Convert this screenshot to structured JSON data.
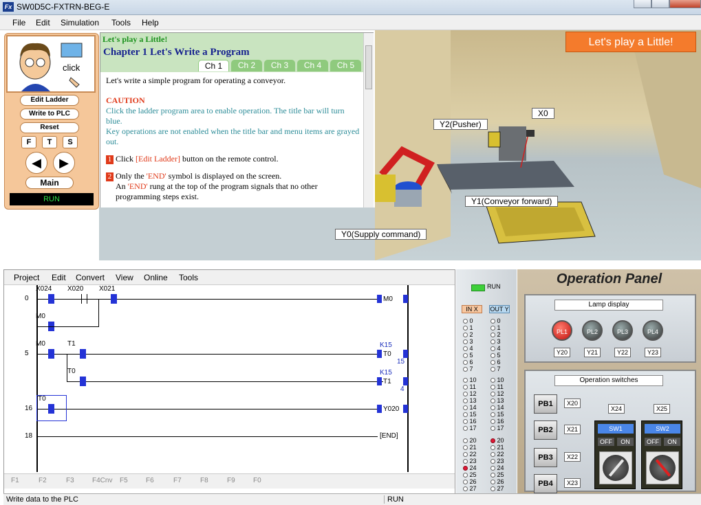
{
  "window": {
    "title": "SW0D5C-FXTRN-BEG-E",
    "icon": "Fx"
  },
  "menu": [
    "File",
    "Edit",
    "Simulation",
    "Tools",
    "Help"
  ],
  "remote": {
    "click_label": "click",
    "edit_ladder": "Edit Ladder",
    "write_plc": "Write to PLC",
    "reset": "Reset",
    "f": "F",
    "t": "T",
    "s": "S",
    "main": "Main",
    "run": "RUN"
  },
  "tutorial": {
    "lets_play": "Let's play a Little!",
    "chapter_title": "Chapter 1  Let's Write a Program",
    "tabs": [
      "Ch 1",
      "Ch 2",
      "Ch 3",
      "Ch 4",
      "Ch 5"
    ],
    "intro": "Let's write a simple program for operating a conveyor.",
    "caution": "CAUTION",
    "caution_text1": "Click the ladder program area to enable operation. The title bar will turn blue.",
    "caution_text2": "Key operations are not enabled when the title bar and menu items are grayed out.",
    "step1_num": "1",
    "step1_pre": "Click ",
    "step1_btn": "[Edit Ladder]",
    "step1_post": " button on the remote control.",
    "step2_num": "2",
    "step2_pre": "Only the ",
    "step2_end": "'END'",
    "step2_post": " symbol is displayed on the screen.",
    "step3_pre": "An ",
    "step3_end": "'END'",
    "step3_post": " rung at the top of the program signals that no other",
    "step4": "programming steps exist."
  },
  "scene": {
    "banner": "Let's play a Little!",
    "labels": {
      "y2": "Y2(Pusher)",
      "x0": "X0",
      "y1": "Y1(Conveyor forward)",
      "y0": "Y0(Supply command)"
    }
  },
  "ladder": {
    "menu": [
      "Project",
      "Edit",
      "Convert",
      "View",
      "Online",
      "Tools"
    ],
    "steps": [
      "0",
      "5",
      "16",
      "18"
    ],
    "devices": {
      "x024": "X024",
      "x020": "X020",
      "x021": "X021",
      "m0a": "M0",
      "m0b": "M0",
      "t1": "T1",
      "t0": "T0",
      "t0b": "T0"
    },
    "coils": {
      "m0": "M0",
      "t0": "T0",
      "t1": "T1",
      "y020": "Y020",
      "end": "END",
      "k15a": "K15",
      "k15b": "K15"
    },
    "values": {
      "t0": "15",
      "t1": "4"
    },
    "fkeys": [
      "F1",
      "F2",
      "F3",
      "F4Cnv",
      "F5",
      "F6",
      "F7",
      "F8",
      "F9",
      "F0"
    ]
  },
  "status": {
    "left": "Write data to the PLC",
    "run": "RUN"
  },
  "io": {
    "run": "RUN",
    "inx": "IN X",
    "outy": "OUT Y",
    "rows1": [
      "0",
      "1",
      "2",
      "3",
      "4",
      "5",
      "6",
      "7"
    ],
    "rows2": [
      "10",
      "11",
      "12",
      "13",
      "14",
      "15",
      "16",
      "17"
    ],
    "rows3": [
      "20",
      "21",
      "22",
      "23",
      "24",
      "25",
      "26",
      "27"
    ]
  },
  "op": {
    "title": "Operation Panel",
    "lamp_display": "Lamp display",
    "lamps": [
      "PL1",
      "PL2",
      "PL3",
      "PL4"
    ],
    "lamp_y": [
      "Y20",
      "Y21",
      "Y22",
      "Y23"
    ],
    "switches_title": "Operation switches",
    "pbs": [
      "PB1",
      "PB2",
      "PB3",
      "PB4"
    ],
    "pb_x": [
      "X20",
      "X21",
      "X22",
      "X23"
    ],
    "sw": [
      {
        "x": "X24",
        "name": "SW1",
        "off": "OFF",
        "on": "ON"
      },
      {
        "x": "X25",
        "name": "SW2",
        "off": "OFF",
        "on": "ON"
      }
    ]
  }
}
